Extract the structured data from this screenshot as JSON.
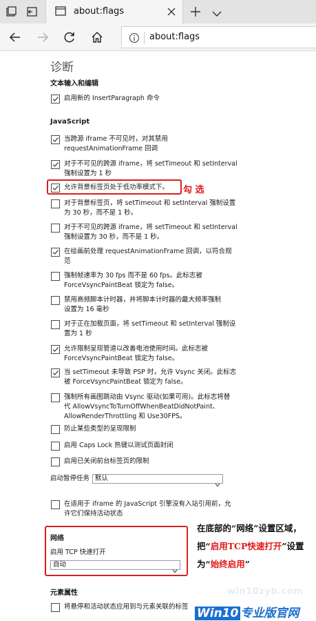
{
  "tab": {
    "title": "about:flags"
  },
  "address": {
    "url": "about:flags"
  },
  "page": {
    "heading": "诊断",
    "sections": {
      "text_input": "文本输入和编辑",
      "javascript": "JavaScript",
      "network": "网络",
      "element_props": "元素属性"
    },
    "text_input_flags": [
      {
        "label": "启用新的 InsertParagraph 命令",
        "checked": true
      }
    ],
    "js_flags": [
      {
        "lines": [
          "当跨源 iframe 不可见时，对其禁用",
          "requestAnimationFrame 回调"
        ],
        "checked": true
      },
      {
        "lines": [
          "对于不可见的跨源 iframe，将 setTimeout 和 setInterval",
          "强制设置为 1 秒"
        ],
        "checked": true
      },
      {
        "lines": [
          "允许背景标签页处于低功率模式下。"
        ],
        "checked": true
      },
      {
        "lines": [
          "对于背景标签页，将 setTimeout 和 setInterval 强制设置",
          "为 30 秒，而不是 1 秒。"
        ],
        "checked": false
      },
      {
        "lines": [
          "对于不可见的跨源 iframe，将 setTimeout 和 setInterval",
          "强制设置为 30 秒，而不是 1 秒。"
        ],
        "checked": false
      },
      {
        "lines": [
          "在绘画前处理 requestAnimationFrame 回调，以符合规",
          "范"
        ],
        "checked": true
      },
      {
        "lines": [
          "强制帧速率为 30 fps 而不是 60 fps。此标志被",
          "ForceVsyncPaintBeat 锁定为 false。"
        ],
        "checked": false
      },
      {
        "lines": [
          "禁用高频脚本计时器，并将脚本计时器的最大频率强制",
          "设置为 16 毫秒"
        ],
        "checked": false
      },
      {
        "lines": [
          "对于正在加载页面，将 setTimeout 和 setInterval 强制设",
          "置为 1 秒"
        ],
        "checked": false
      },
      {
        "lines": [
          "允许限制呈现管道以改善电池使用时间。此标志被",
          "ForceVsyncPaintBeat 锁定为 false。"
        ],
        "checked": true
      },
      {
        "lines": [
          "当 setTimeout 未导致 PSP 时，允许 Vsync 关闭。此标志",
          "被 ForceVsyncPaintBeat 锁定为 false。"
        ],
        "checked": true
      },
      {
        "lines": [
          "强制所有画图跳动由 Vsync 驱动(如果可用)。此标志将替",
          "代 AllowVsyncToTurnOffWhenBeatDidNotPaint、",
          "AllowRenderThrottling 和 Use30FPS。"
        ],
        "checked": false
      },
      {
        "lines": [
          "防止某些类型的呈现限制"
        ],
        "checked": false
      },
      {
        "lines": [
          "启用 Caps Lock 热键以测试页面封闭"
        ],
        "checked": false
      },
      {
        "lines": [
          "启用已关闭前台标签页的限制"
        ],
        "checked": false
      }
    ],
    "pause_tasks": {
      "label": "启动暂停任务",
      "value": "默认"
    },
    "iframe_flag": {
      "lines": [
        "在适用于 iframe 的 JavaScript 引擎没有入站引用前，允",
        "许它们保持活动状态"
      ],
      "checked": false
    },
    "tcp_fast_open": {
      "label": "启用 TCP 快速打开",
      "value": "自动"
    },
    "element_flag": {
      "label": "将悬停和活动状态应用到与元素关联的标签",
      "checked": false
    }
  },
  "annotations": {
    "check_hint": "勾 选",
    "instruction": {
      "p1": "在底部的“网络”设置区域，把“",
      "p2": "启用TCP快速打开",
      "p3": "”设置为“",
      "p4": "始终启用",
      "p5": "”"
    }
  },
  "watermark": {
    "url": "win10zyb.com",
    "logo_win": "Win10",
    "logo_rest": "专业版官网"
  }
}
